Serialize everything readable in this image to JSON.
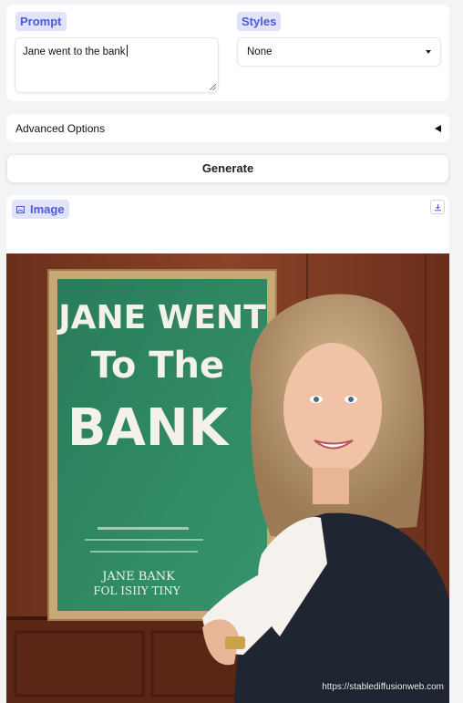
{
  "prompt": {
    "label": "Prompt",
    "value": "Jane went to the bank"
  },
  "styles": {
    "label": "Styles",
    "selected": "None"
  },
  "advanced": {
    "label": "Advanced Options"
  },
  "generate": {
    "label": "Generate"
  },
  "image": {
    "label": "Image",
    "poster_lines": [
      "JANE WENT",
      "To The",
      "BANK"
    ],
    "poster_footer": [
      "JANE BANK",
      "FOL ISIIY TINY"
    ],
    "watermark": "https://stablediffusionweb.com"
  },
  "colors": {
    "accent": "#4f5bd5",
    "chip_bg": "#e0e3fb",
    "poster_green": "#2f8a63",
    "wood": "#7a3a22"
  }
}
